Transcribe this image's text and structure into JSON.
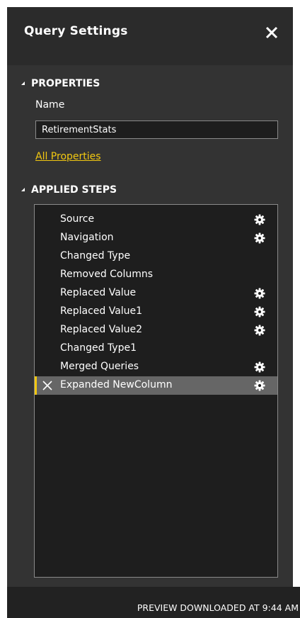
{
  "pane": {
    "title": "Query Settings"
  },
  "properties": {
    "heading": "PROPERTIES",
    "name_label": "Name",
    "name_value": "RetirementStats",
    "all_properties_link": "All Properties"
  },
  "applied_steps": {
    "heading": "APPLIED STEPS",
    "steps": [
      {
        "label": "Source",
        "has_settings": true,
        "selected": false
      },
      {
        "label": "Navigation",
        "has_settings": true,
        "selected": false
      },
      {
        "label": "Changed Type",
        "has_settings": false,
        "selected": false
      },
      {
        "label": "Removed Columns",
        "has_settings": false,
        "selected": false
      },
      {
        "label": "Replaced Value",
        "has_settings": true,
        "selected": false
      },
      {
        "label": "Replaced Value1",
        "has_settings": true,
        "selected": false
      },
      {
        "label": "Replaced Value2",
        "has_settings": true,
        "selected": false
      },
      {
        "label": "Changed Type1",
        "has_settings": false,
        "selected": false
      },
      {
        "label": "Merged Queries",
        "has_settings": true,
        "selected": false
      },
      {
        "label": "Expanded NewColumn",
        "has_settings": true,
        "selected": true
      }
    ]
  },
  "status_bar": {
    "text": "PREVIEW DOWNLOADED AT 9:44 AM"
  },
  "colors": {
    "pane_bg": "#333333",
    "header_bg": "#2b2b2b",
    "list_bg": "#1e1e1e",
    "selected_bg": "#666666",
    "accent": "#f2c811"
  },
  "icons": {
    "close": "close-icon",
    "collapse": "collapse-triangle-icon",
    "settings": "gear-icon",
    "delete_step": "delete-x-icon"
  }
}
